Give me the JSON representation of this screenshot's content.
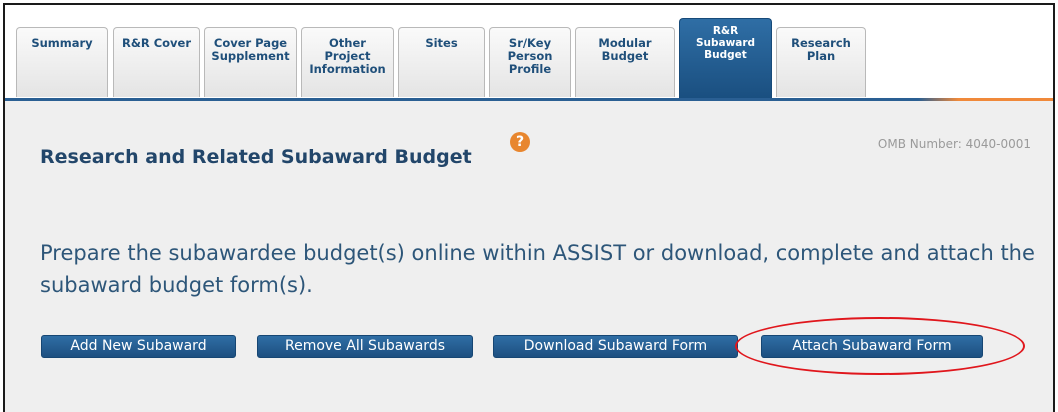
{
  "tabs": [
    {
      "label": "Summary",
      "active": false
    },
    {
      "label": "R&R Cover",
      "active": false
    },
    {
      "label": "Cover Page\nSupplement",
      "active": false
    },
    {
      "label": "Other\nProject\nInformation",
      "active": false
    },
    {
      "label": "Sites",
      "active": false
    },
    {
      "label": "Sr/Key\nPerson\nProfile",
      "active": false
    },
    {
      "label": "Modular\nBudget",
      "active": false
    },
    {
      "label": "R&R\nSubaward\nBudget",
      "active": true
    },
    {
      "label": "Research\nPlan",
      "active": false
    }
  ],
  "page": {
    "title": "Research and Related Subaward Budget",
    "help_icon": "?",
    "omb_number": "OMB Number: 4040-0001",
    "instructions": "Prepare the subawardee budget(s) online within ASSIST or download, complete and attach the subaward budget form(s)."
  },
  "buttons": {
    "add_new": "Add New Subaward",
    "remove_all": "Remove All Subawards",
    "download_form": "Download Subaward Form",
    "attach_form": "Attach Subaward Form"
  },
  "colors": {
    "accent_blue": "#1f4f7a",
    "tab_active": "#2a5f93",
    "help_orange": "#e8862e",
    "highlight_red": "#e0161c"
  }
}
